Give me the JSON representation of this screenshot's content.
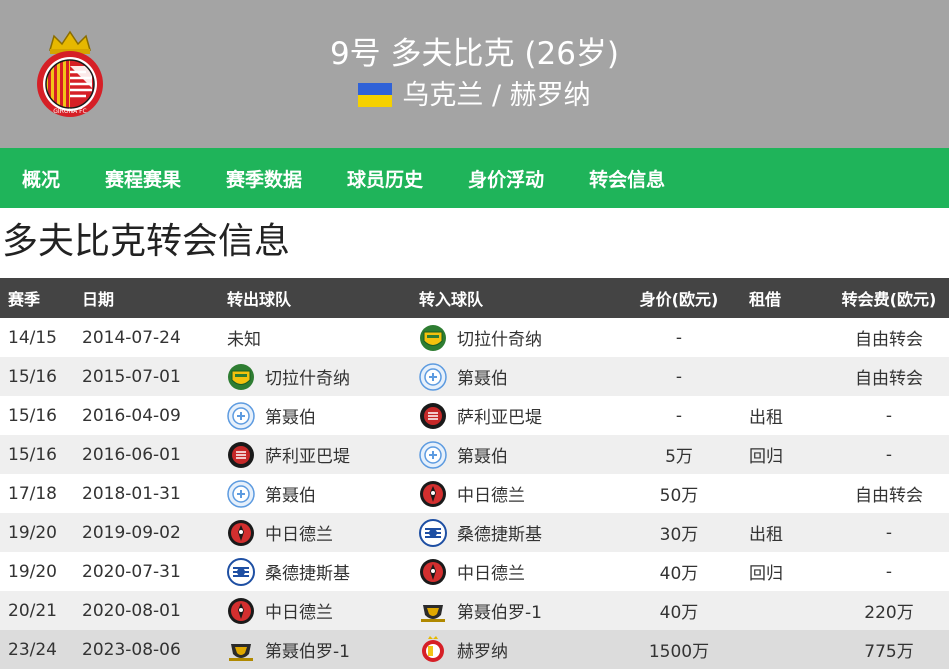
{
  "header": {
    "title": "9号 多夫比克 (26岁)",
    "nationality": "乌克兰 / 赫罗纳",
    "flag_colors": [
      "#2f62d8",
      "#f5d100"
    ],
    "club_logo_icon": "girona-fc-crest",
    "club_logo_text": "GIRONA FC"
  },
  "nav": {
    "tabs": [
      "概况",
      "赛程赛果",
      "赛季数据",
      "球员历史",
      "身价浮动",
      "转会信息"
    ]
  },
  "section_title": "多夫比克转会信息",
  "table": {
    "columns": [
      "赛季",
      "日期",
      "转出球队",
      "转入球队",
      "身价(欧元)",
      "租借",
      "转会费(欧元)"
    ],
    "rows": [
      {
        "season": "14/15",
        "date": "2014-07-24",
        "from": "未知",
        "from_icon": "",
        "to": "切拉什奇纳",
        "to_icon": "cherkashchyna-crest",
        "value": "-",
        "loan": "",
        "fee": "自由转会"
      },
      {
        "season": "15/16",
        "date": "2015-07-01",
        "from": "切拉什奇纳",
        "from_icon": "cherkashchyna-crest",
        "to": "第聂伯",
        "to_icon": "dnipro-crest",
        "value": "-",
        "loan": "",
        "fee": "自由转会"
      },
      {
        "season": "15/16",
        "date": "2016-04-09",
        "from": "第聂伯",
        "from_icon": "dnipro-crest",
        "to": "萨利亚巴堤",
        "to_icon": "sarpsborg-crest",
        "value": "-",
        "loan": "出租",
        "fee": "-"
      },
      {
        "season": "15/16",
        "date": "2016-06-01",
        "from": "萨利亚巴堤",
        "from_icon": "sarpsborg-crest",
        "to": "第聂伯",
        "to_icon": "dnipro-crest",
        "value": "5万",
        "loan": "回归",
        "fee": "-"
      },
      {
        "season": "17/18",
        "date": "2018-01-31",
        "from": "第聂伯",
        "from_icon": "dnipro-crest",
        "to": "中日德兰",
        "to_icon": "midtjylland-crest",
        "value": "50万",
        "loan": "",
        "fee": "自由转会"
      },
      {
        "season": "19/20",
        "date": "2019-09-02",
        "from": "中日德兰",
        "from_icon": "midtjylland-crest",
        "to": "桑德捷斯基",
        "to_icon": "sonderjyske-crest",
        "value": "30万",
        "loan": "出租",
        "fee": "-"
      },
      {
        "season": "19/20",
        "date": "2020-07-31",
        "from": "桑德捷斯基",
        "from_icon": "sonderjyske-crest",
        "to": "中日德兰",
        "to_icon": "midtjylland-crest",
        "value": "40万",
        "loan": "回归",
        "fee": "-"
      },
      {
        "season": "20/21",
        "date": "2020-08-01",
        "from": "中日德兰",
        "from_icon": "midtjylland-crest",
        "to": "第聂伯罗-1",
        "to_icon": "dnipro1-crest",
        "value": "40万",
        "loan": "",
        "fee": "220万"
      },
      {
        "season": "23/24",
        "date": "2023-08-06",
        "from": "第聂伯罗-1",
        "from_icon": "dnipro1-crest",
        "to": "赫罗纳",
        "to_icon": "girona-crest",
        "value": "1500万",
        "loan": "",
        "fee": "775万"
      }
    ]
  },
  "colors": {
    "header_bg": "#a4a4a4",
    "nav_bg": "#1fb45a",
    "table_head_bg": "#444444",
    "row_alt_bg": "#efefef"
  }
}
